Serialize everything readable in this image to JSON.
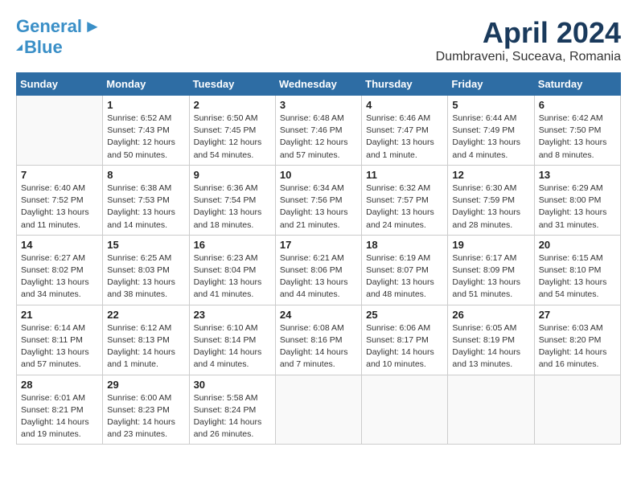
{
  "header": {
    "logo_line1": "General",
    "logo_line2": "Blue",
    "title": "April 2024",
    "subtitle": "Dumbraveni, Suceava, Romania"
  },
  "days_of_week": [
    "Sunday",
    "Monday",
    "Tuesday",
    "Wednesday",
    "Thursday",
    "Friday",
    "Saturday"
  ],
  "weeks": [
    {
      "days": [
        {
          "number": "",
          "info": ""
        },
        {
          "number": "1",
          "info": "Sunrise: 6:52 AM\nSunset: 7:43 PM\nDaylight: 12 hours\nand 50 minutes."
        },
        {
          "number": "2",
          "info": "Sunrise: 6:50 AM\nSunset: 7:45 PM\nDaylight: 12 hours\nand 54 minutes."
        },
        {
          "number": "3",
          "info": "Sunrise: 6:48 AM\nSunset: 7:46 PM\nDaylight: 12 hours\nand 57 minutes."
        },
        {
          "number": "4",
          "info": "Sunrise: 6:46 AM\nSunset: 7:47 PM\nDaylight: 13 hours\nand 1 minute."
        },
        {
          "number": "5",
          "info": "Sunrise: 6:44 AM\nSunset: 7:49 PM\nDaylight: 13 hours\nand 4 minutes."
        },
        {
          "number": "6",
          "info": "Sunrise: 6:42 AM\nSunset: 7:50 PM\nDaylight: 13 hours\nand 8 minutes."
        }
      ]
    },
    {
      "days": [
        {
          "number": "7",
          "info": "Sunrise: 6:40 AM\nSunset: 7:52 PM\nDaylight: 13 hours\nand 11 minutes."
        },
        {
          "number": "8",
          "info": "Sunrise: 6:38 AM\nSunset: 7:53 PM\nDaylight: 13 hours\nand 14 minutes."
        },
        {
          "number": "9",
          "info": "Sunrise: 6:36 AM\nSunset: 7:54 PM\nDaylight: 13 hours\nand 18 minutes."
        },
        {
          "number": "10",
          "info": "Sunrise: 6:34 AM\nSunset: 7:56 PM\nDaylight: 13 hours\nand 21 minutes."
        },
        {
          "number": "11",
          "info": "Sunrise: 6:32 AM\nSunset: 7:57 PM\nDaylight: 13 hours\nand 24 minutes."
        },
        {
          "number": "12",
          "info": "Sunrise: 6:30 AM\nSunset: 7:59 PM\nDaylight: 13 hours\nand 28 minutes."
        },
        {
          "number": "13",
          "info": "Sunrise: 6:29 AM\nSunset: 8:00 PM\nDaylight: 13 hours\nand 31 minutes."
        }
      ]
    },
    {
      "days": [
        {
          "number": "14",
          "info": "Sunrise: 6:27 AM\nSunset: 8:02 PM\nDaylight: 13 hours\nand 34 minutes."
        },
        {
          "number": "15",
          "info": "Sunrise: 6:25 AM\nSunset: 8:03 PM\nDaylight: 13 hours\nand 38 minutes."
        },
        {
          "number": "16",
          "info": "Sunrise: 6:23 AM\nSunset: 8:04 PM\nDaylight: 13 hours\nand 41 minutes."
        },
        {
          "number": "17",
          "info": "Sunrise: 6:21 AM\nSunset: 8:06 PM\nDaylight: 13 hours\nand 44 minutes."
        },
        {
          "number": "18",
          "info": "Sunrise: 6:19 AM\nSunset: 8:07 PM\nDaylight: 13 hours\nand 48 minutes."
        },
        {
          "number": "19",
          "info": "Sunrise: 6:17 AM\nSunset: 8:09 PM\nDaylight: 13 hours\nand 51 minutes."
        },
        {
          "number": "20",
          "info": "Sunrise: 6:15 AM\nSunset: 8:10 PM\nDaylight: 13 hours\nand 54 minutes."
        }
      ]
    },
    {
      "days": [
        {
          "number": "21",
          "info": "Sunrise: 6:14 AM\nSunset: 8:11 PM\nDaylight: 13 hours\nand 57 minutes."
        },
        {
          "number": "22",
          "info": "Sunrise: 6:12 AM\nSunset: 8:13 PM\nDaylight: 14 hours\nand 1 minute."
        },
        {
          "number": "23",
          "info": "Sunrise: 6:10 AM\nSunset: 8:14 PM\nDaylight: 14 hours\nand 4 minutes."
        },
        {
          "number": "24",
          "info": "Sunrise: 6:08 AM\nSunset: 8:16 PM\nDaylight: 14 hours\nand 7 minutes."
        },
        {
          "number": "25",
          "info": "Sunrise: 6:06 AM\nSunset: 8:17 PM\nDaylight: 14 hours\nand 10 minutes."
        },
        {
          "number": "26",
          "info": "Sunrise: 6:05 AM\nSunset: 8:19 PM\nDaylight: 14 hours\nand 13 minutes."
        },
        {
          "number": "27",
          "info": "Sunrise: 6:03 AM\nSunset: 8:20 PM\nDaylight: 14 hours\nand 16 minutes."
        }
      ]
    },
    {
      "days": [
        {
          "number": "28",
          "info": "Sunrise: 6:01 AM\nSunset: 8:21 PM\nDaylight: 14 hours\nand 19 minutes."
        },
        {
          "number": "29",
          "info": "Sunrise: 6:00 AM\nSunset: 8:23 PM\nDaylight: 14 hours\nand 23 minutes."
        },
        {
          "number": "30",
          "info": "Sunrise: 5:58 AM\nSunset: 8:24 PM\nDaylight: 14 hours\nand 26 minutes."
        },
        {
          "number": "",
          "info": ""
        },
        {
          "number": "",
          "info": ""
        },
        {
          "number": "",
          "info": ""
        },
        {
          "number": "",
          "info": ""
        }
      ]
    }
  ]
}
